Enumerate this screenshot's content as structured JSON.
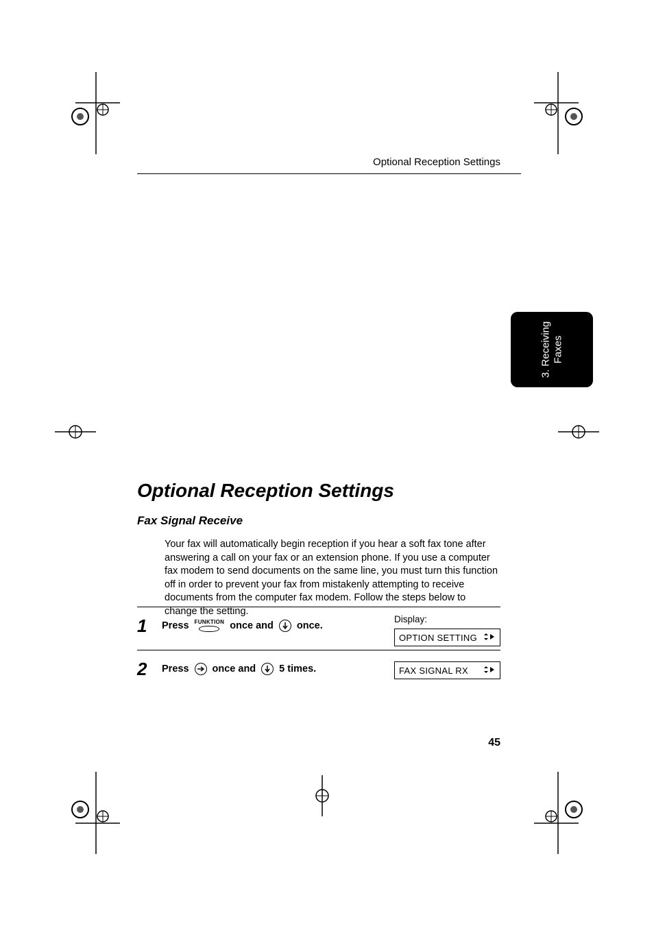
{
  "header": "Optional Reception Settings",
  "side_tab": "3. Receiving\nFaxes",
  "title": "Optional Reception Settings",
  "subtitle": "Fax Signal Receive",
  "intro": "Your fax will automatically begin reception if you hear a soft fax tone after answering a call on your fax or an extension phone. If you use a computer fax modem to send documents on the same line, you must turn this function off in order to prevent your fax from mistakenly attempting to receive documents from the computer fax modem. Follow the steps below to change the setting.",
  "steps": [
    {
      "num": "1",
      "parts": {
        "press": "Press",
        "funktion_label": "FUNKTION",
        "once_and": "once and",
        "once_end": "once."
      },
      "display_label": "Display:",
      "lcd": "OPTION SETTING"
    },
    {
      "num": "2",
      "parts": {
        "press": "Press",
        "once_and": "once and",
        "times": "5 times."
      },
      "lcd": "FAX SIGNAL RX"
    }
  ],
  "page_number": "45",
  "icons": {
    "down_arrow": "down-arrow-icon",
    "right_arrow": "right-arrow-icon",
    "nav_updown_right": "nav-updown-right-icon"
  }
}
